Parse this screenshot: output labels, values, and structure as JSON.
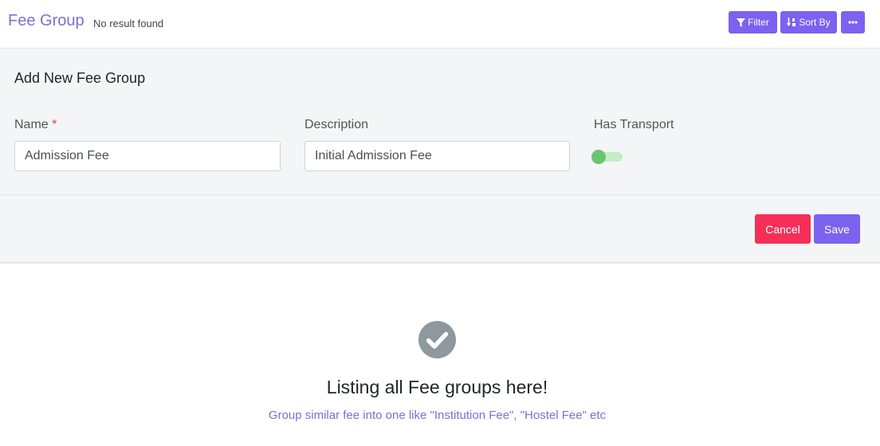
{
  "header": {
    "title": "Fee Group",
    "result_text": "No result found",
    "filter_label": "Filter",
    "sort_label": "Sort By",
    "more_label": "•••"
  },
  "form": {
    "heading": "Add New Fee Group",
    "name_label": "Name",
    "required_mark": "*",
    "name_value": "Admission Fee",
    "description_label": "Description",
    "description_value": "Initial Admission Fee",
    "transport_label": "Has Transport",
    "transport_enabled": false,
    "cancel_label": "Cancel",
    "save_label": "Save"
  },
  "empty_state": {
    "icon": "check-circle-icon",
    "title": "Listing all Fee groups here!",
    "subtitle": "Group similar fee into one like \"Institution Fee\", \"Hostel Fee\" etc"
  },
  "colors": {
    "accent": "#7b62f0",
    "title": "#7b6fd6",
    "danger": "#f52f57",
    "toggle": "#6cc36f",
    "panel_bg": "#f4f5f7"
  }
}
